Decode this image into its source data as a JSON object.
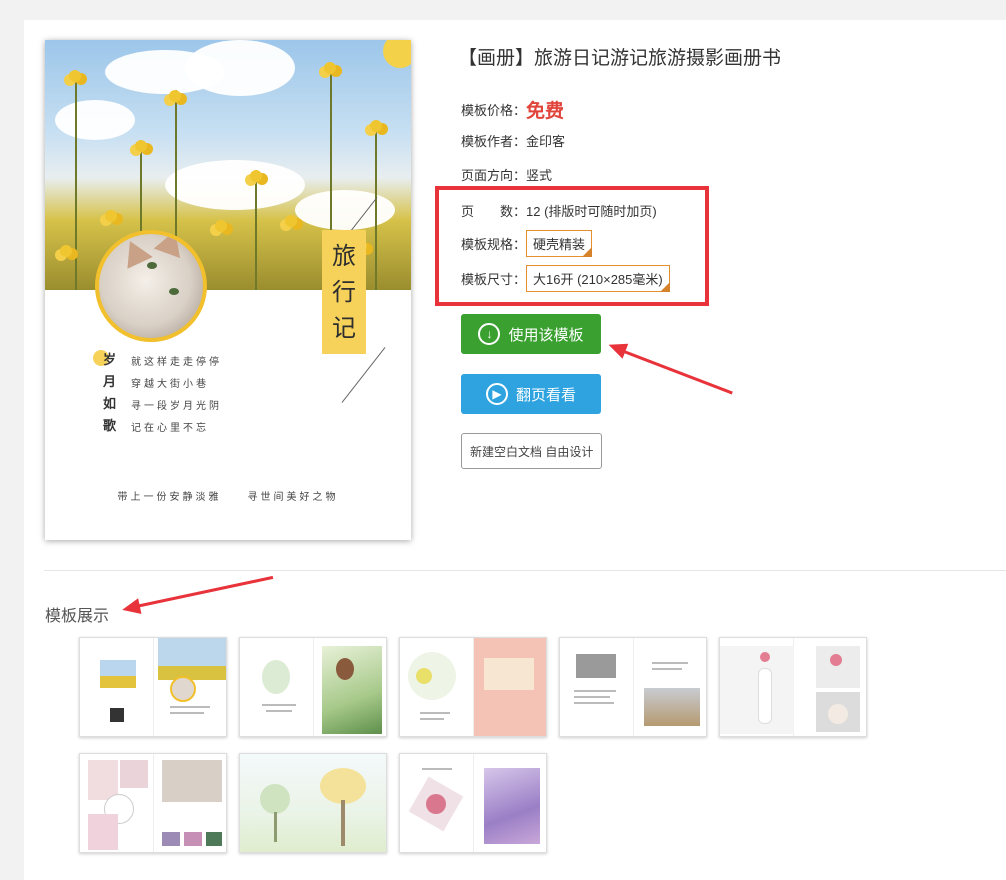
{
  "product": {
    "title": "【画册】旅游日记游记旅游摄影画册书",
    "price_label": "模板价格：",
    "price_value": "免费",
    "author_label": "模板作者：",
    "author_value": "金印客",
    "orientation_label": "页面方向：",
    "orientation_value": "竖式",
    "pages_label": "页　　数：",
    "pages_value": "12 (排版时可随时加页)",
    "spec_label": "模板规格：",
    "spec_value": "硬壳精装",
    "size_label": "模板尺寸：",
    "size_value": "大16开 (210×285毫米)"
  },
  "cover": {
    "title_chars": [
      "旅",
      "行",
      "记"
    ],
    "poem_left": [
      "岁",
      "月",
      "如",
      "歌"
    ],
    "poem_right": [
      "就这样走走停停",
      "穿越大街小巷",
      "寻一段岁月光阴",
      "记在心里不忘"
    ],
    "tagline": "带上一份安静淡雅　　寻世间美好之物"
  },
  "buttons": {
    "use_template": "使用该模板",
    "flip_view": "翻页看看",
    "new_blank": "新建空白文档 自由设计"
  },
  "icons": {
    "use_template": "download-circle-icon",
    "flip_view": "play-circle-icon"
  },
  "showcase": {
    "title": "模板展示",
    "thumbnail_count": 8
  },
  "colors": {
    "price": "#e0443a",
    "green_button": "#3aa030",
    "blue_button": "#2ea3e0",
    "highlight": "#e8333b",
    "spec_border": "#e59030"
  }
}
